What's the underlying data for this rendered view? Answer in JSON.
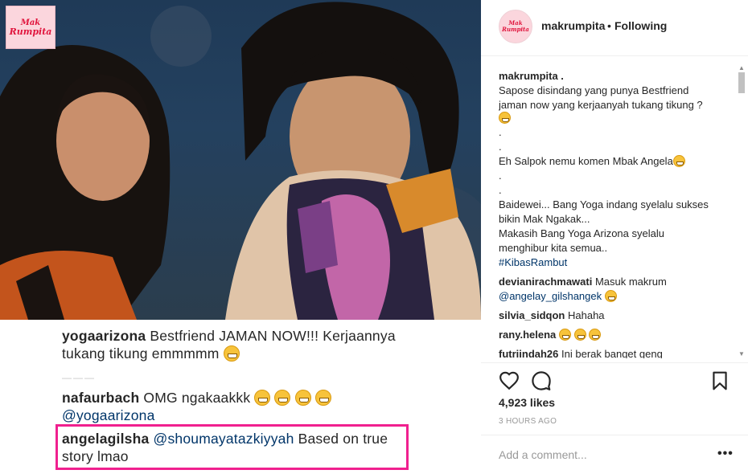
{
  "media": {
    "logo_line1": "Mak",
    "logo_line2": "Rumpita",
    "screenshot_comments": {
      "post_author": "yogaarizona",
      "post_text_1": "Bestfriend JAMAN NOW!!! Kerjaannya",
      "post_text_2": "tukang tikung emmmmm",
      "separator": "———",
      "c1_user": "nafaurbach",
      "c1_text": "OMG ngakaakkk",
      "c1_mention": "@yogaarizona",
      "c2_user": "angelagilsha",
      "c2_mention": "@shoumayatazkiyyah",
      "c2_text_1": "Based on true",
      "c2_text_2": "story lmao"
    }
  },
  "header": {
    "username": "makrumpita",
    "separator": "•",
    "follow_status": "Following",
    "avatar_line1": "Mak",
    "avatar_line2": "Rumpita"
  },
  "caption": {
    "username": "makrumpita .",
    "line1": "Sapose disindang yang punya Bestfriend",
    "line2": "jaman now yang kerjaanyah tukang tikung ?",
    "dot1": ".",
    "dot2": ".",
    "line3": "Eh Salpok nemu komen Mbak Angela",
    "dot3": ".",
    "dot4": ".",
    "line4": "Baidewei... Bang Yoga indang syelalu sukses",
    "line5": "bikin Mak Ngakak...",
    "line6": "Makasih Bang Yoga Arizona syelalu",
    "line7": "menghibur kita semua..",
    "hashtag": "#KibasRambut"
  },
  "comments": [
    {
      "user": "devianirachmawati",
      "text": "Masuk makrum",
      "mention": "@angelay_gilshangek"
    },
    {
      "user": "silvia_sidqon",
      "text": "Hahaha"
    },
    {
      "user": "rany.helena",
      "text": ""
    },
    {
      "user": "futriindah26",
      "text": "Ini berak banget geng"
    }
  ],
  "actions": {
    "like_icon": "heart-icon",
    "comment_icon": "comment-bubble-icon",
    "save_icon": "bookmark-icon"
  },
  "likes": "4,923 likes",
  "time_ago": "3 HOURS AGO",
  "comment_box": {
    "placeholder": "Add a comment...",
    "more": "•••"
  }
}
